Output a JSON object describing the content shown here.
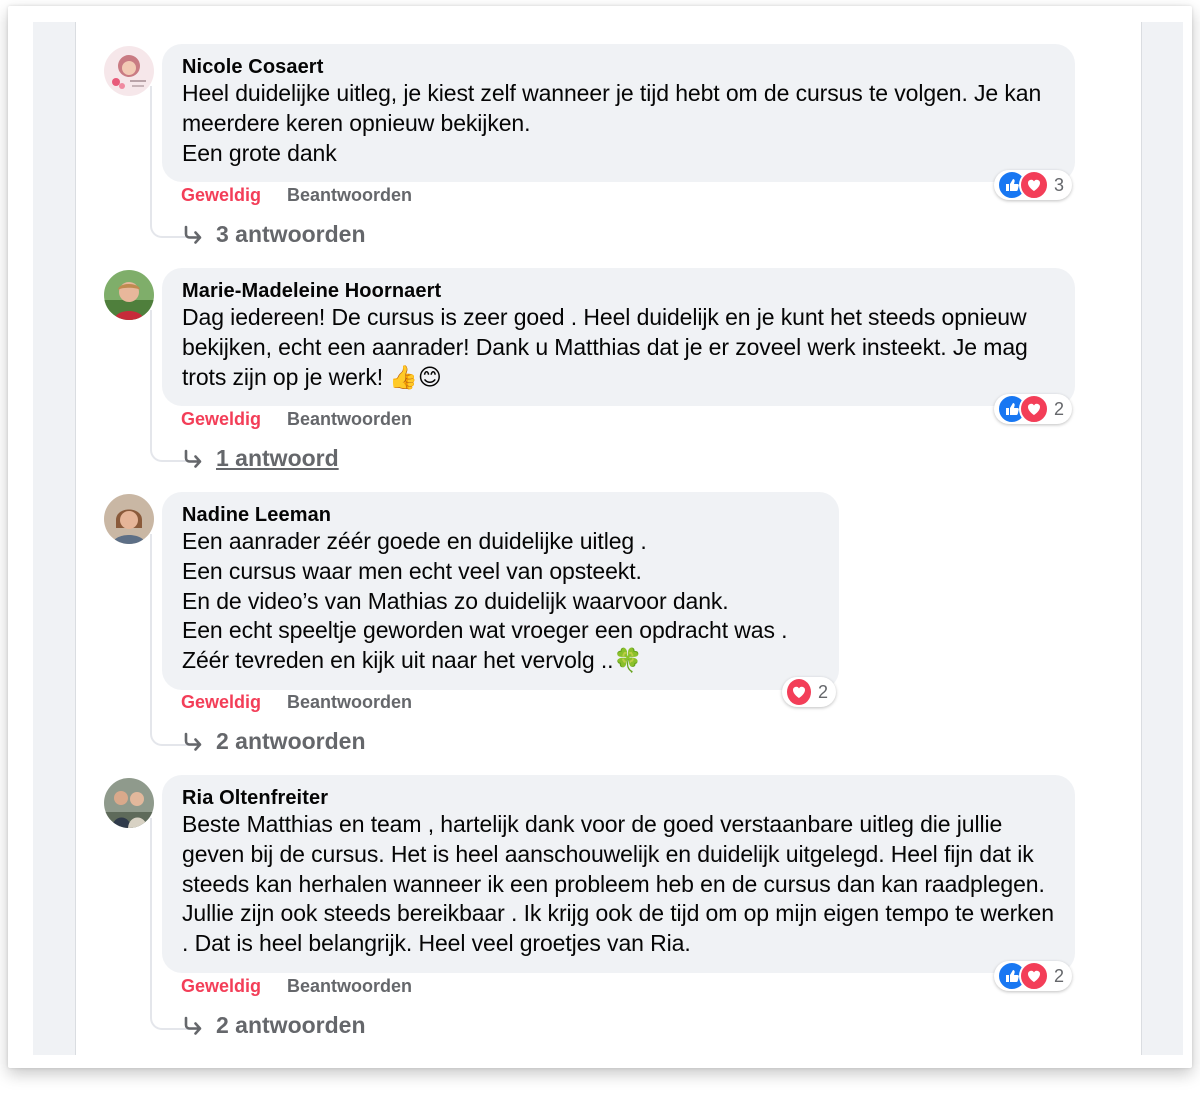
{
  "labels": {
    "like": "Geweldig",
    "reply": "Beantwoorden"
  },
  "colors": {
    "like_blue": "#1877f2",
    "love_red": "#f33e58",
    "bubble_bg": "#f0f2f5",
    "meta_gray": "#65676b"
  },
  "comments": [
    {
      "author": "Nicole Cosaert",
      "text": "Heel duidelijke uitleg, je kiest zelf wanneer je tijd hebt om de cursus te volgen. Je kan meerdere keren opnieuw bekijken.\nEen grote dank",
      "reactions": {
        "icons": [
          "like-icon",
          "love-icon"
        ],
        "count": "3"
      },
      "replies": "3 antwoorden"
    },
    {
      "author": "Marie-Madeleine Hoornaert",
      "text": "Dag iedereen! De cursus is zeer goed . Heel duidelijk en je kunt het steeds opnieuw bekijken, echt een aanrader! Dank u Matthias dat je er zoveel werk insteekt. Je mag trots zijn op je werk! 👍😊",
      "reactions": {
        "icons": [
          "like-icon",
          "love-icon"
        ],
        "count": "2"
      },
      "replies": "1 antwoord"
    },
    {
      "author": "Nadine Leeman",
      "text": "Een aanrader zéér goede en duidelijke uitleg .\nEen cursus waar men echt veel van opsteekt.\nEn de video’s van Mathias zo duidelijk waarvoor dank.\nEen echt speeltje geworden wat vroeger een opdracht was .\nZéér tevreden en kijk uit naar het vervolg ..🍀",
      "reactions": {
        "icons": [
          "love-icon"
        ],
        "count": "2"
      },
      "replies": "2 antwoorden"
    },
    {
      "author": "Ria Oltenfreiter",
      "text": "Beste Matthias en team , hartelijk dank voor de goed verstaanbare uitleg die jullie geven bij de cursus. Het is heel aanschouwelijk en duidelijk uitgelegd. Heel fijn dat ik steeds kan herhalen wanneer ik een probleem heb en de cursus dan kan raadplegen. Jullie zijn ook steeds bereikbaar . Ik krijg ook de tijd om op mijn eigen tempo te werken . Dat is heel belangrijk. Heel veel groetjes van Ria.",
      "reactions": {
        "icons": [
          "like-icon",
          "love-icon"
        ],
        "count": "2"
      },
      "replies": "2 antwoorden"
    }
  ]
}
